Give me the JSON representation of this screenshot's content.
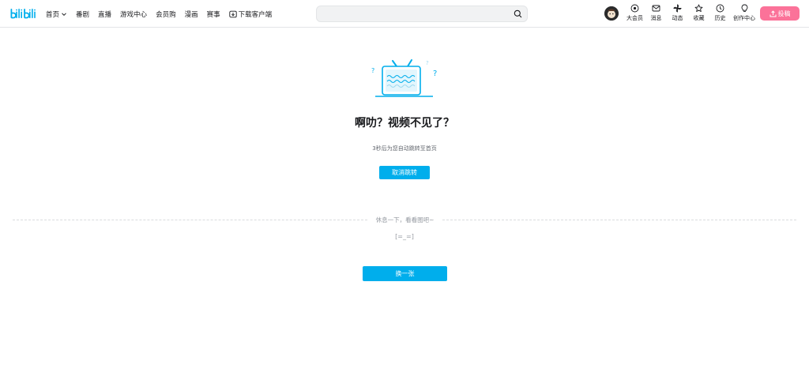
{
  "header": {
    "logo_text": "bilibili",
    "nav": [
      {
        "label": "首页",
        "has_dropdown": true
      },
      {
        "label": "番剧"
      },
      {
        "label": "直播"
      },
      {
        "label": "游戏中心"
      },
      {
        "label": "会员购"
      },
      {
        "label": "漫画"
      },
      {
        "label": "赛事"
      },
      {
        "label": "下载客户端",
        "icon": "download-icon"
      }
    ],
    "search": {
      "value": "",
      "placeholder": ""
    },
    "right_nav": [
      {
        "label": "大会员",
        "icon": "vip-icon"
      },
      {
        "label": "消息",
        "icon": "message-icon"
      },
      {
        "label": "动态",
        "icon": "dynamic-icon"
      },
      {
        "label": "收藏",
        "icon": "star-icon"
      },
      {
        "label": "历史",
        "icon": "clock-icon"
      },
      {
        "label": "创作中心",
        "icon": "bulb-icon"
      }
    ],
    "upload_label": "投稿"
  },
  "main": {
    "title": "啊叻？视频不见了？",
    "redirect_note": "3秒后为您自动跳转至首页",
    "cancel_label": "取消跳转",
    "divider_text": "休息一下，看看图吧~",
    "kaomoji": "[=_=]",
    "next_label": "换一张"
  },
  "colors": {
    "accent": "#00aeec",
    "upload": "#fb7299",
    "text": "#18191c",
    "muted": "#9499a0"
  }
}
